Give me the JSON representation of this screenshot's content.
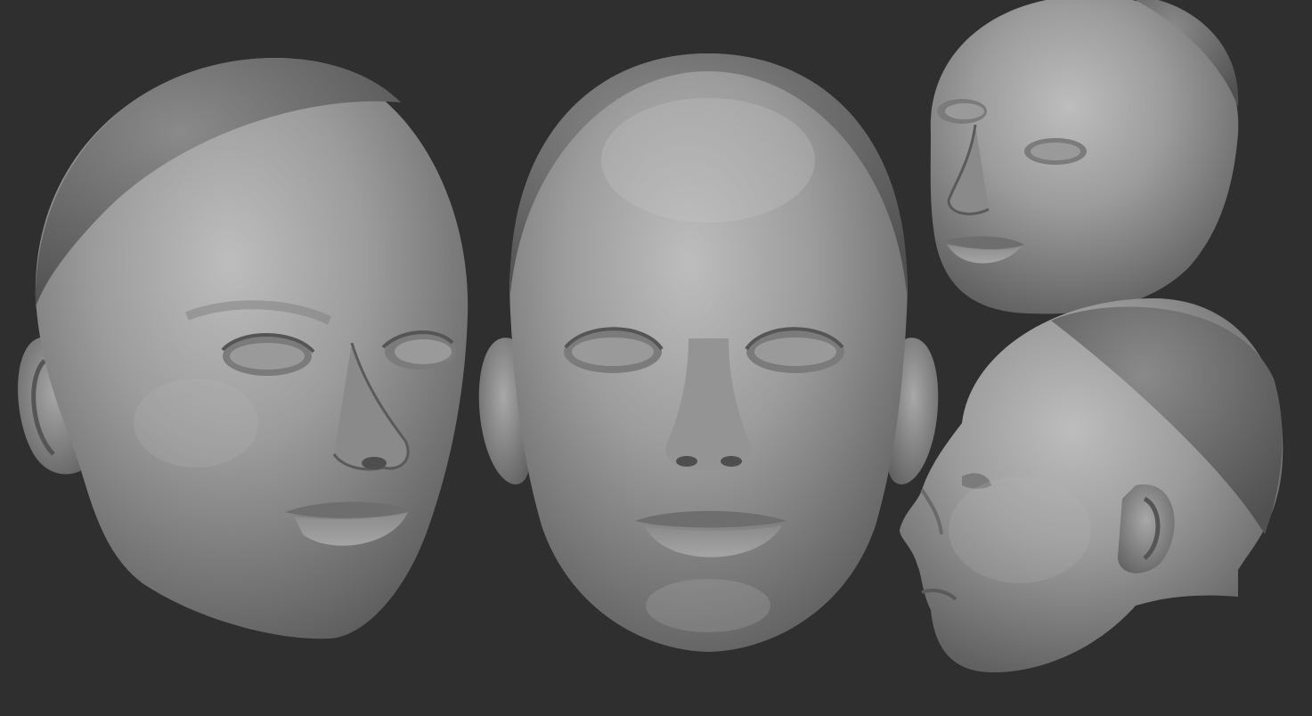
{
  "scene": {
    "description_free": true,
    "background_color": "#2f2f2f",
    "clay_color": "#8f8f8f",
    "cap_color": "#6f6f6f"
  },
  "views": [
    {
      "id": "three-quarter-left",
      "icon": "sculpted-head-render"
    },
    {
      "id": "front",
      "icon": "sculpted-head-render"
    },
    {
      "id": "three-quarter-right",
      "icon": "sculpted-head-render"
    },
    {
      "id": "profile",
      "icon": "sculpted-head-render"
    }
  ]
}
